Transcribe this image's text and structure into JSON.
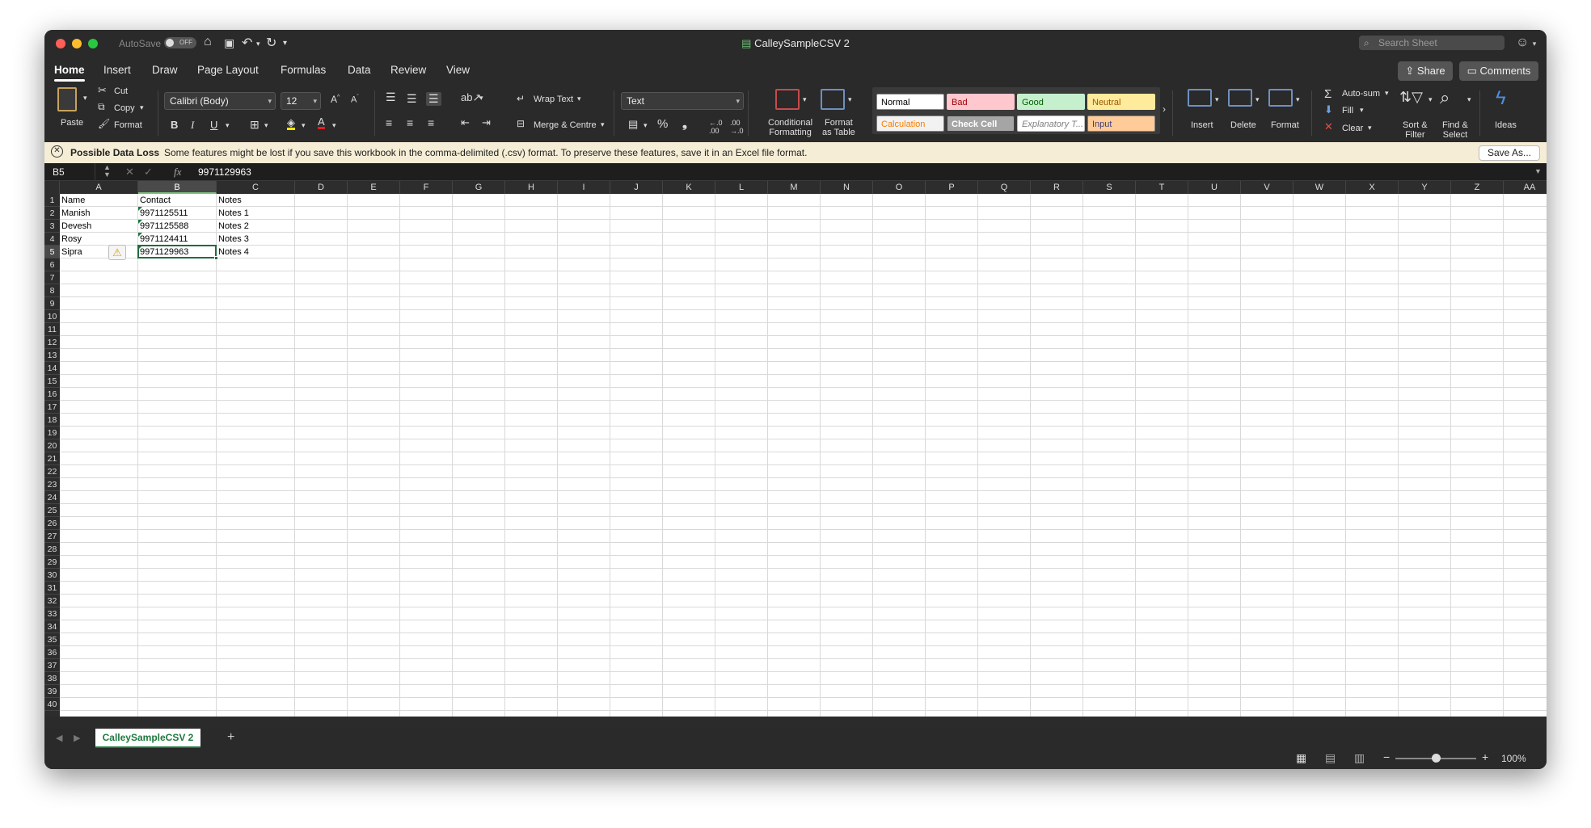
{
  "window": {
    "title": "CalleySampleCSV 2",
    "autosave_label": "AutoSave",
    "autosave_state": "OFF",
    "search_placeholder": "Search Sheet"
  },
  "tabs": [
    "Home",
    "Insert",
    "Draw",
    "Page Layout",
    "Formulas",
    "Data",
    "Review",
    "View"
  ],
  "active_tab": "Home",
  "share_label": "Share",
  "comments_label": "Comments",
  "ribbon": {
    "paste": "Paste",
    "cut": "Cut",
    "copy": "Copy",
    "format_painter": "Format",
    "font_name": "Calibri (Body)",
    "font_size": "12",
    "wrap_text": "Wrap Text",
    "merge_centre": "Merge & Centre",
    "number_format": "Text",
    "conditional_formatting": [
      "Conditional",
      "Formatting"
    ],
    "format_as_table": [
      "Format",
      "as Table"
    ],
    "styles": [
      {
        "name": "Normal",
        "bg": "#ffffff",
        "fg": "#000000",
        "border": "#888888"
      },
      {
        "name": "Bad",
        "bg": "#ffc7ce",
        "fg": "#9c0006",
        "border": "#ffc7ce"
      },
      {
        "name": "Good",
        "bg": "#c6efce",
        "fg": "#006100",
        "border": "#c6efce"
      },
      {
        "name": "Neutral",
        "bg": "#ffeb9c",
        "fg": "#9c5700",
        "border": "#ffeb9c"
      },
      {
        "name": "Calculation",
        "bg": "#f2f2f2",
        "fg": "#fa7d00",
        "border": "#7f7f7f"
      },
      {
        "name": "Check Cell",
        "bg": "#a5a5a5",
        "fg": "#ffffff",
        "border": "#3f3f3f"
      },
      {
        "name": "Explanatory T...",
        "bg": "#ffffff",
        "fg": "#7f7f7f",
        "border": "#bbbbbb"
      },
      {
        "name": "Input",
        "bg": "#ffcc99",
        "fg": "#3f3f76",
        "border": "#7f7f7f"
      }
    ],
    "insert": "Insert",
    "delete": "Delete",
    "format": "Format",
    "autosum": "Auto-sum",
    "fill": "Fill",
    "clear": "Clear",
    "sort_filter": [
      "Sort &",
      "Filter"
    ],
    "find_select": [
      "Find &",
      "Select"
    ],
    "ideas": "Ideas"
  },
  "message_bar": {
    "title": "Possible Data Loss",
    "text": "Some features might be lost if you save this workbook in the comma-delimited (.csv) format. To preserve these features, save it in an Excel file format.",
    "button": "Save As..."
  },
  "formula_bar": {
    "name_box": "B5",
    "fx": "fx",
    "value": "9971129963"
  },
  "columns": [
    "A",
    "B",
    "C",
    "D",
    "E",
    "F",
    "G",
    "H",
    "I",
    "J",
    "K",
    "L",
    "M",
    "N",
    "O",
    "P",
    "Q",
    "R",
    "S",
    "T",
    "U",
    "V",
    "W",
    "X",
    "Y",
    "Z",
    "AA"
  ],
  "selected_column": "B",
  "selected_row": 5,
  "row_count": 40,
  "cells": [
    {
      "ref": "A1",
      "value": "Name"
    },
    {
      "ref": "B1",
      "value": "Contact"
    },
    {
      "ref": "C1",
      "value": "Notes"
    },
    {
      "ref": "A2",
      "value": "Manish"
    },
    {
      "ref": "B2",
      "value": "9971125511"
    },
    {
      "ref": "C2",
      "value": "Notes 1"
    },
    {
      "ref": "A3",
      "value": "Devesh"
    },
    {
      "ref": "B3",
      "value": "9971125588"
    },
    {
      "ref": "C3",
      "value": "Notes 2"
    },
    {
      "ref": "A4",
      "value": "Rosy"
    },
    {
      "ref": "B4",
      "value": "9971124411"
    },
    {
      "ref": "C4",
      "value": "Notes 3"
    },
    {
      "ref": "A5",
      "value": "Sipra"
    },
    {
      "ref": "B5",
      "value": "9971129963"
    },
    {
      "ref": "C5",
      "value": "Notes 4"
    }
  ],
  "sheet_tab": "CalleySampleCSV 2",
  "zoom": "100%"
}
